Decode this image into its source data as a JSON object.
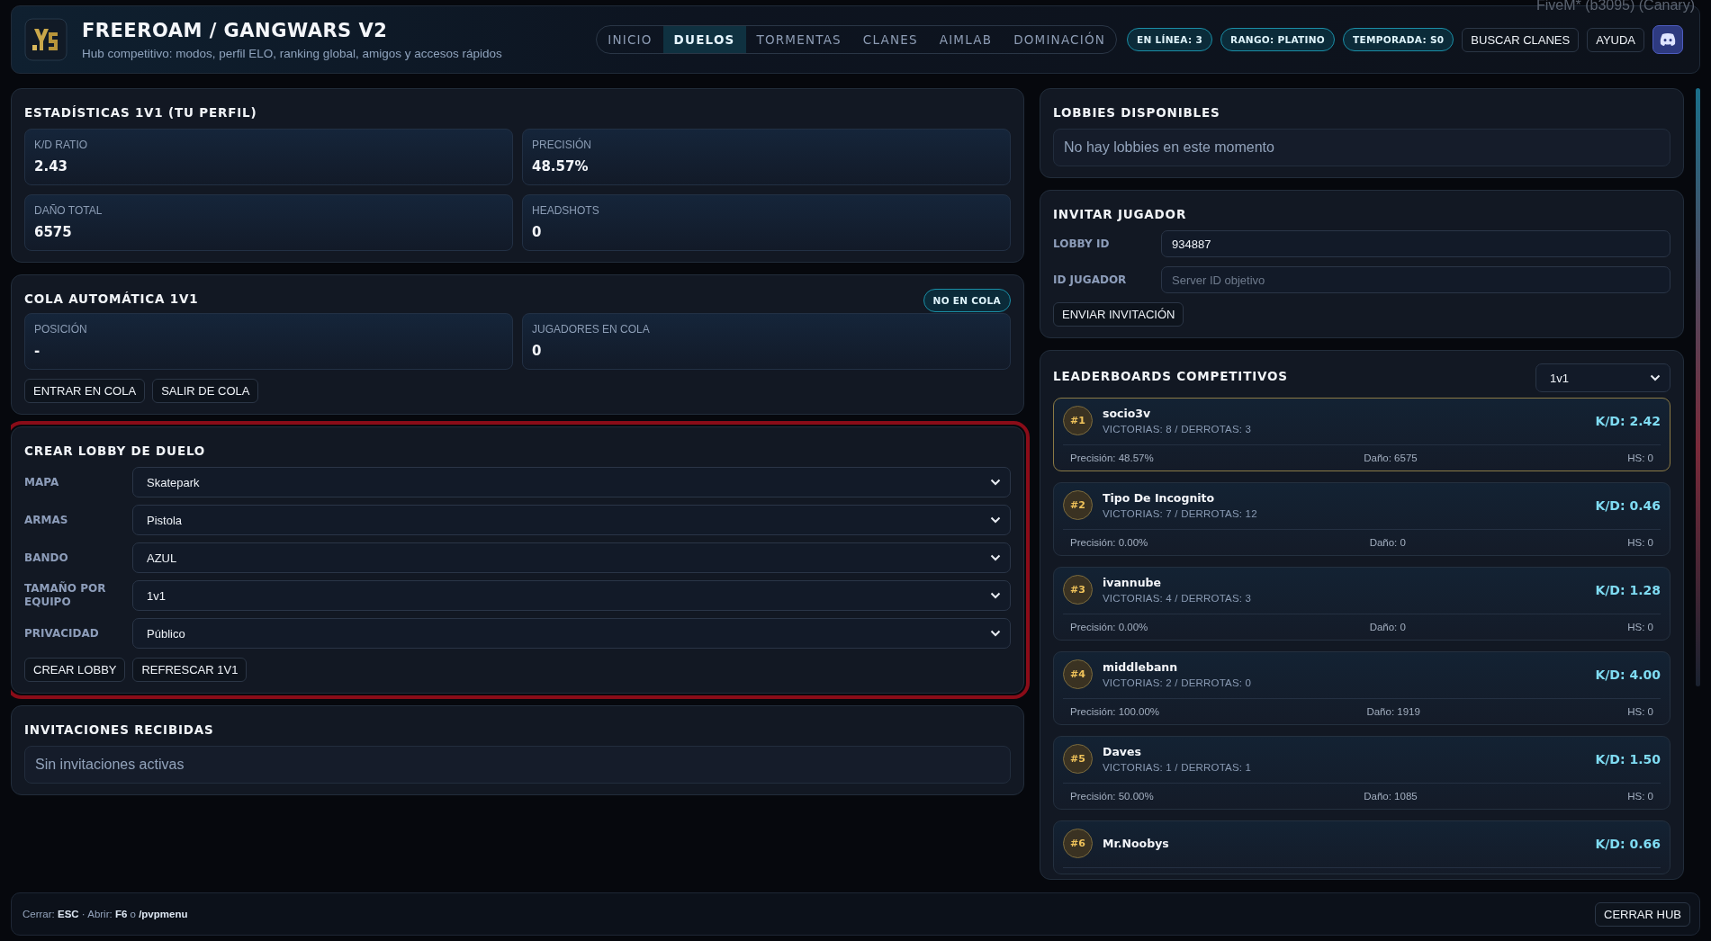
{
  "window": {
    "title": "FiveM* (b3095) (Canary)"
  },
  "header": {
    "title": "FREEROAM / GANGWARS V2",
    "subtitle": "Hub competitivo: modos, perfil ELO, ranking global, amigos y accesos rápidos",
    "tabs": [
      {
        "label": "INICIO",
        "selected": false
      },
      {
        "label": "DUELOS",
        "selected": true
      },
      {
        "label": "TORMENTAS",
        "selected": false
      },
      {
        "label": "CLANES",
        "selected": false
      },
      {
        "label": "AIMLAB",
        "selected": false
      },
      {
        "label": "DOMINACIÓN",
        "selected": false
      }
    ],
    "badges": [
      "EN LÍNEA: 3",
      "RANGO: PLATINO",
      "TEMPORADA: S0"
    ],
    "buttons": [
      "BUSCAR CLANES",
      "AYUDA"
    ]
  },
  "stats_panel": {
    "title": "ESTADÍSTICAS 1V1 (TU PERFIL)",
    "tiles": [
      {
        "label": "K/D RATIO",
        "value": "2.43"
      },
      {
        "label": "PRECISIÓN",
        "value": "48.57%"
      },
      {
        "label": "DAÑO TOTAL",
        "value": "6575"
      },
      {
        "label": "HEADSHOTS",
        "value": "0"
      }
    ]
  },
  "queue_panel": {
    "title": "COLA AUTOMÁTICA 1V1",
    "status": "NO EN COLA",
    "tiles": [
      {
        "label": "POSICIÓN",
        "value": "-"
      },
      {
        "label": "JUGADORES EN COLA",
        "value": "0"
      }
    ],
    "buttons": [
      "ENTRAR EN COLA",
      "SALIR DE COLA"
    ]
  },
  "create_lobby_panel": {
    "title": "CREAR LOBBY DE DUELO",
    "highlighted": true,
    "fields": [
      {
        "label": "MAPA",
        "value": "Skatepark"
      },
      {
        "label": "ARMAS",
        "value": "Pistola"
      },
      {
        "label": "BANDO",
        "value": "AZUL"
      },
      {
        "label": "TAMAÑO POR EQUIPO",
        "value": "1v1"
      },
      {
        "label": "PRIVACIDAD",
        "value": "Público"
      }
    ],
    "buttons": [
      "CREAR LOBBY",
      "REFRESCAR 1V1"
    ]
  },
  "invitations_panel": {
    "title": "INVITACIONES RECIBIDAS",
    "empty_text": "Sin invitaciones activas"
  },
  "lobbies_panel": {
    "title": "LOBBIES DISPONIBLES",
    "empty_text": "No hay lobbies en este momento"
  },
  "invite_panel": {
    "title": "INVITAR JUGADOR",
    "fields": [
      {
        "label": "LOBBY ID",
        "value": "934887"
      },
      {
        "label": "ID JUGADOR",
        "placeholder": "Server ID objetivo"
      }
    ],
    "button": "ENVIAR INVITACIÓN"
  },
  "leaderboard_panel": {
    "title": "LEADERBOARDS COMPETITIVOS",
    "mode": "1v1",
    "entries": [
      {
        "rank": "#1",
        "name": "socio3v",
        "record": "VICTORIAS: 8 / DERROTAS: 3",
        "kd": "K/D: 2.42",
        "accuracy": "Precisión: 48.57%",
        "damage": "Daño: 6575",
        "hs": "HS: 0",
        "top": true
      },
      {
        "rank": "#2",
        "name": "Tipo De Incognito",
        "record": "VICTORIAS: 7 / DERROTAS: 12",
        "kd": "K/D: 0.46",
        "accuracy": "Precisión: 0.00%",
        "damage": "Daño: 0",
        "hs": "HS: 0",
        "top": false
      },
      {
        "rank": "#3",
        "name": "ivannube",
        "record": "VICTORIAS: 4 / DERROTAS: 3",
        "kd": "K/D: 1.28",
        "accuracy": "Precisión: 0.00%",
        "damage": "Daño: 0",
        "hs": "HS: 0",
        "top": false
      },
      {
        "rank": "#4",
        "name": "middlebann",
        "record": "VICTORIAS: 2 / DERROTAS: 0",
        "kd": "K/D: 4.00",
        "accuracy": "Precisión: 100.00%",
        "damage": "Daño: 1919",
        "hs": "HS: 0",
        "top": false
      },
      {
        "rank": "#5",
        "name": "Daves",
        "record": "VICTORIAS: 1 / DERROTAS: 1",
        "kd": "K/D: 1.50",
        "accuracy": "Precisión: 50.00%",
        "damage": "Daño: 1085",
        "hs": "HS: 0",
        "top": false
      },
      {
        "rank": "#6",
        "name": "Mr.Noobys",
        "kd": "K/D: 0.66",
        "top": false
      }
    ]
  },
  "footer": {
    "hint": "Cerrar: **ESC** · Abrir: **F6** o **/pvpmenu**",
    "button": "CERRAR HUB"
  }
}
